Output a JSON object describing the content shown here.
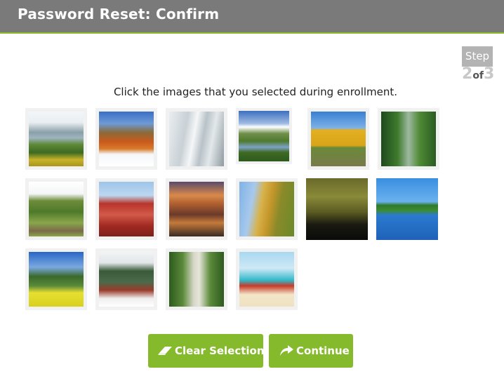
{
  "header": {
    "title": "Password Reset: Confirm"
  },
  "step": {
    "label": "Step",
    "current": "2",
    "of": "of",
    "total": "3"
  },
  "instruction": "Click the images that you selected during enrollment.",
  "images": [
    {
      "icon": "mountain-lake-flowers-photo"
    },
    {
      "icon": "autumn-trees-snow-photo"
    },
    {
      "icon": "glacier-photo"
    },
    {
      "icon": "river-valley-photo"
    },
    {
      "icon": "yellow-house-photo"
    },
    {
      "icon": "green-mountain-valley-photo"
    },
    {
      "icon": "orchard-path-photo"
    },
    {
      "icon": "kremlin-cathedral-photo"
    },
    {
      "icon": "canyon-sunset-photo"
    },
    {
      "icon": "wheat-ears-photo"
    },
    {
      "icon": "misty-forest-silhouette-photo"
    },
    {
      "icon": "lake-reflection-photo"
    },
    {
      "icon": "rapeseed-field-trees-photo"
    },
    {
      "icon": "snowy-pines-truck-photo"
    },
    {
      "icon": "garden-path-photo"
    },
    {
      "icon": "lifeguard-tower-beach-photo"
    }
  ],
  "buttons": {
    "clear_label": "Clear Selection",
    "continue_label": "Continue"
  },
  "colors": {
    "accent": "#86ba2d",
    "header": "#7a7a7a"
  }
}
